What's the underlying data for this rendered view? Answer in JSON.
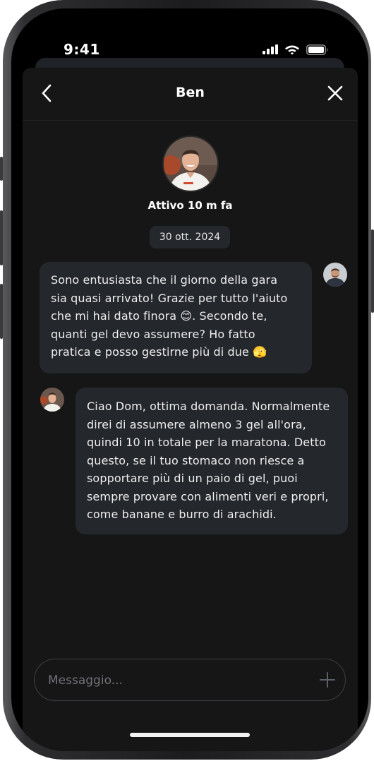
{
  "status_bar": {
    "time": "9:41",
    "icons": [
      "cellular-signal-icon",
      "wifi-icon",
      "battery-icon"
    ]
  },
  "header": {
    "title": "Ben",
    "back_icon": "chevron-left-icon",
    "close_icon": "close-icon"
  },
  "contact": {
    "name": "Ben",
    "presence": "Attivo 10 m fa"
  },
  "conversation": {
    "date": "30 ott. 2024",
    "messages": [
      {
        "sender": "me",
        "lines": [
          "Sono entusiasta che il giorno della gara",
          "sia quasi arrivato! Grazie per tutto l'aiuto",
          "che mi hai dato finora 😊. Secondo te,",
          "quanti gel devo assumere? Ho fatto",
          "pratica e posso gestirne più di due 🫣"
        ]
      },
      {
        "sender": "Ben",
        "lines": [
          "Ciao Dom, ottima domanda. Normalmente",
          "direi di assumere almeno 3 gel all'ora,",
          "quindi 10 in totale per la maratona. Detto",
          "questo, se il tuo stomaco non riesce a",
          "sopportare più di un paio di gel, puoi",
          "sempre provare con alimenti veri e propri,",
          "come banane e burro di arachidi."
        ]
      }
    ]
  },
  "composer": {
    "placeholder": "Messaggio...",
    "value": "",
    "send_icon": "plus-icon"
  },
  "colors": {
    "sheet_background": "#161616",
    "bubble_background": "#24272b",
    "text": "#ffffff",
    "placeholder": "#707276"
  }
}
